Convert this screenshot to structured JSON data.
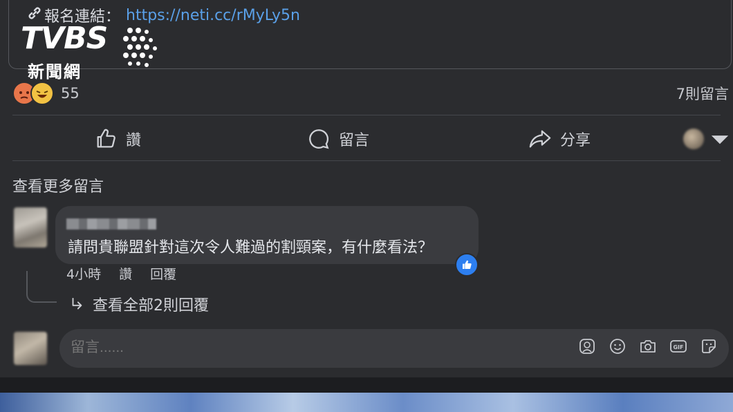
{
  "post": {
    "link_label": "報名連結：",
    "link_url": "https://neti.cc/rMyLy5n"
  },
  "watermark": {
    "brand": "TVBS",
    "sub": "新聞網"
  },
  "reactions": {
    "count": "55",
    "comments_count": "7則留言"
  },
  "actions": {
    "like": "讚",
    "comment": "留言",
    "share": "分享"
  },
  "comments": {
    "view_more": "查看更多留言",
    "items": [
      {
        "text": "請問貴聯盟針對這次令人難過的割頸案，有什麼看法？",
        "time": "4小時",
        "like": "讚",
        "reply": "回覆",
        "view_replies": "查看全部2則回覆"
      }
    ]
  },
  "composer": {
    "placeholder": "留言......"
  },
  "colors": {
    "background": "#2b2c2f",
    "bubble": "#3a3b3f",
    "link": "#5aa0e8",
    "like_badge": "#2d7ff0"
  }
}
